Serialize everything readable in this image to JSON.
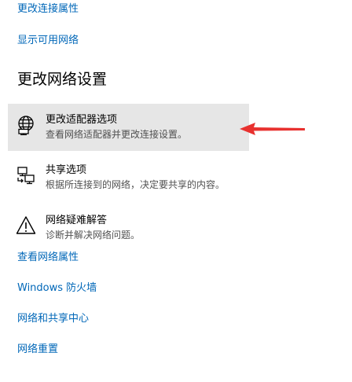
{
  "top_links": {
    "change_connection_properties": "更改连接属性",
    "show_available_networks": "显示可用网络"
  },
  "section_heading": "更改网络设置",
  "options": [
    {
      "title": "更改适配器选项",
      "description": "查看网络适配器并更改连接设置。",
      "icon": "network-adapter-icon",
      "selected": true
    },
    {
      "title": "共享选项",
      "description": "根据所连接到的网络，决定要共享的内容。",
      "icon": "sharing-icon",
      "selected": false
    },
    {
      "title": "网络疑难解答",
      "description": "诊断并解决网络问题。",
      "icon": "warning-icon",
      "selected": false
    }
  ],
  "bottom_links": {
    "view_network_properties": "查看网络属性",
    "windows_firewall": "Windows 防火墙",
    "network_sharing_center": "网络和共享中心",
    "network_reset": "网络重置"
  },
  "colors": {
    "link": "#0067b8",
    "selected_background": "#e6e6e6",
    "annotation_arrow": "#e8312f"
  }
}
